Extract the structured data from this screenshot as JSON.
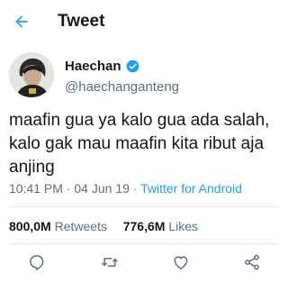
{
  "header": {
    "title": "Tweet",
    "back_icon": "arrow-left-icon"
  },
  "author": {
    "display_name": "Haechan",
    "handle": "@haechanganteng",
    "verified": true,
    "avatar_icon": "avatar"
  },
  "tweet": {
    "text": "maafin gua ya kalo gua ada salah,\nkalo gak mau maafin kita ribut aja\nanjing",
    "time": "10:41 PM",
    "date": "04 Jun 19",
    "separator": "·",
    "source": "Twitter for Android"
  },
  "stats": {
    "retweets_count": "800,0M",
    "retweets_label": "Retweets",
    "likes_count": "776,6M",
    "likes_label": "Likes"
  },
  "actions": {
    "reply_icon": "reply-icon",
    "retweet_icon": "retweet-icon",
    "like_icon": "heart-icon",
    "share_icon": "share-icon"
  },
  "colors": {
    "accent": "#1da1f2",
    "secondary_text": "#5b7083",
    "divider": "#e1e8ed"
  }
}
